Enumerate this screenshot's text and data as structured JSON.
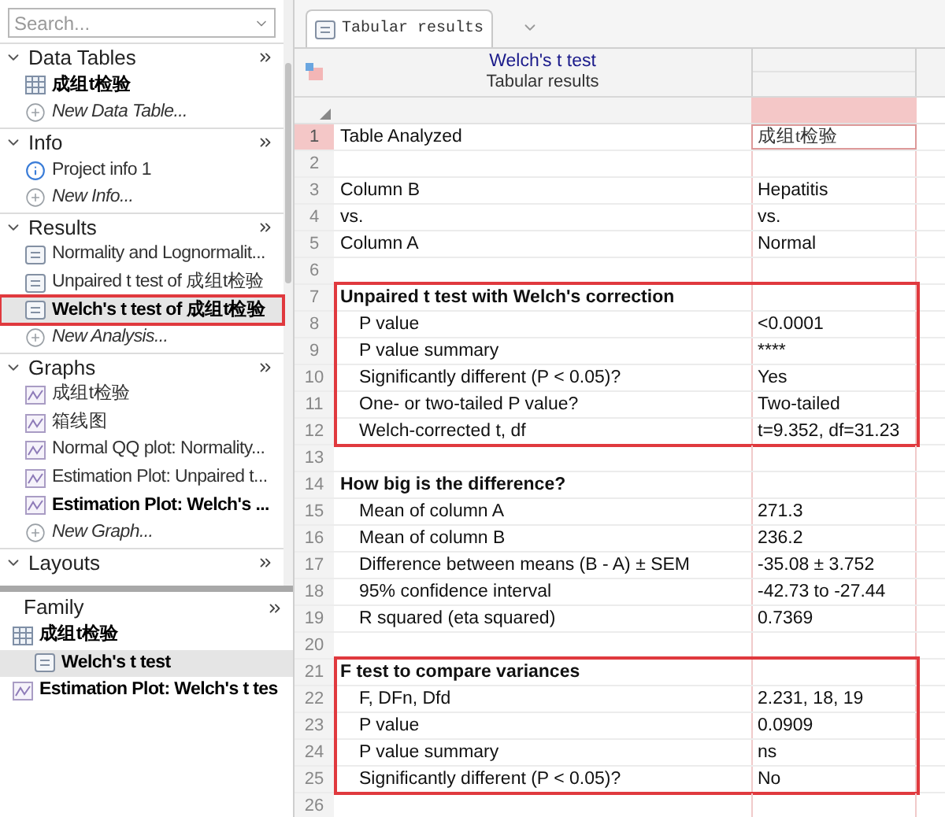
{
  "search": {
    "placeholder": "Search..."
  },
  "navigator": {
    "sections": [
      {
        "title": "Data Tables",
        "expanded": true,
        "items": [
          {
            "kind": "table",
            "label": "成组t检验",
            "bold": true,
            "selected": false,
            "highlighted": false
          },
          {
            "kind": "new",
            "label": "New Data Table...",
            "bold": false,
            "selected": false,
            "highlighted": false
          }
        ]
      },
      {
        "title": "Info",
        "expanded": true,
        "items": [
          {
            "kind": "info",
            "label": "Project info 1",
            "bold": false,
            "selected": false,
            "highlighted": false
          },
          {
            "kind": "new",
            "label": "New Info...",
            "bold": false,
            "selected": false,
            "highlighted": false
          }
        ]
      },
      {
        "title": "Results",
        "expanded": true,
        "items": [
          {
            "kind": "results",
            "label": "Normality and Lognormalit...",
            "bold": false,
            "selected": false,
            "highlighted": false
          },
          {
            "kind": "results",
            "label": "Unpaired t test of 成组t检验",
            "bold": false,
            "selected": false,
            "highlighted": false
          },
          {
            "kind": "results",
            "label": "Welch's t test of 成组t检验",
            "bold": true,
            "selected": true,
            "highlighted": true
          },
          {
            "kind": "new",
            "label": "New Analysis...",
            "bold": false,
            "selected": false,
            "highlighted": false
          }
        ]
      },
      {
        "title": "Graphs",
        "expanded": true,
        "items": [
          {
            "kind": "graph",
            "label": "成组t检验",
            "bold": false,
            "selected": false,
            "highlighted": false
          },
          {
            "kind": "graph",
            "label": "箱线图",
            "bold": false,
            "selected": false,
            "highlighted": false
          },
          {
            "kind": "graph",
            "label": "Normal QQ plot: Normality...",
            "bold": false,
            "selected": false,
            "highlighted": false
          },
          {
            "kind": "graph",
            "label": "Estimation Plot: Unpaired t...",
            "bold": false,
            "selected": false,
            "highlighted": false
          },
          {
            "kind": "graph",
            "label": "Estimation Plot: Welch's ...",
            "bold": true,
            "selected": false,
            "highlighted": false
          },
          {
            "kind": "new",
            "label": "New Graph...",
            "bold": false,
            "selected": false,
            "highlighted": false
          }
        ]
      },
      {
        "title": "Layouts",
        "expanded": true
      }
    ]
  },
  "family": {
    "title": "Family",
    "items": [
      {
        "kind": "table",
        "label": "成组t检验",
        "bold": true,
        "selected": false,
        "children": [
          {
            "kind": "results",
            "label": "Welch's t test",
            "bold": true,
            "selected": true
          }
        ]
      },
      {
        "kind": "graph",
        "label": "Estimation Plot: Welch's t tes",
        "bold": true,
        "selected": false
      }
    ]
  },
  "tabs": [
    {
      "label": "Tabular results",
      "selected": true
    }
  ],
  "sheet": {
    "title": "Welch's t test",
    "subtitle": "Tabular results",
    "value_column": {
      "selected": true
    },
    "groups": [
      {
        "kind": "plain",
        "rows": [
          {
            "number": "1",
            "kind": "plain",
            "label": "Table Analyzed",
            "value": "成组t检验",
            "selected": true
          },
          {
            "number": "2",
            "kind": "blank",
            "selected": false
          },
          {
            "number": "3",
            "kind": "plain",
            "label": "Column B",
            "value": "Hepatitis",
            "selected": false
          },
          {
            "number": "4",
            "kind": "plain",
            "label": "vs.",
            "value": "vs.",
            "selected": false
          },
          {
            "number": "5",
            "kind": "plain",
            "label": "Column A",
            "value": "Normal",
            "selected": false
          },
          {
            "number": "6",
            "kind": "blank",
            "selected": false
          }
        ]
      },
      {
        "kind": "framed",
        "rows": [
          {
            "number": "7",
            "kind": "title",
            "label": "Unpaired t test with Welch's correction",
            "selected": false
          },
          {
            "number": "8",
            "kind": "item",
            "label": "P value",
            "value": "<0.0001",
            "selected": false
          },
          {
            "number": "9",
            "kind": "item",
            "label": "P value summary",
            "value": "****",
            "selected": false
          },
          {
            "number": "10",
            "kind": "item",
            "label": "Significantly different (P < 0.05)?",
            "value": "Yes",
            "selected": false
          },
          {
            "number": "11",
            "kind": "item",
            "label": "One- or two-tailed P value?",
            "value": "Two-tailed",
            "selected": false
          },
          {
            "number": "12",
            "kind": "item",
            "label": "Welch-corrected  t, df",
            "value": "t=9.352, df=31.23",
            "selected": false
          }
        ]
      },
      {
        "kind": "plain",
        "rows": [
          {
            "number": "13",
            "kind": "blank",
            "selected": false
          },
          {
            "number": "14",
            "kind": "title",
            "label": "How big is the difference?",
            "selected": false
          },
          {
            "number": "15",
            "kind": "item",
            "label": "Mean of column A",
            "value": "271.3",
            "selected": false
          },
          {
            "number": "16",
            "kind": "item",
            "label": "Mean of column B",
            "value": "236.2",
            "selected": false
          },
          {
            "number": "17",
            "kind": "item",
            "label": "Difference between means (B - A) ± SEM",
            "value": "-35.08 ± 3.752",
            "selected": false
          },
          {
            "number": "18",
            "kind": "item",
            "label": "95% confidence interval",
            "value": "-42.73 to -27.44",
            "selected": false
          },
          {
            "number": "19",
            "kind": "item",
            "label": "R squared (eta squared)",
            "value": "0.7369",
            "selected": false
          },
          {
            "number": "20",
            "kind": "blank",
            "selected": false
          }
        ]
      },
      {
        "kind": "framed",
        "rows": [
          {
            "number": "21",
            "kind": "title",
            "label": "F test to compare variances",
            "selected": false
          },
          {
            "number": "22",
            "kind": "item",
            "label": "F, DFn, Dfd",
            "value": "2.231, 18, 19",
            "selected": false
          },
          {
            "number": "23",
            "kind": "item",
            "label": "P value",
            "value": "0.0909",
            "selected": false
          },
          {
            "number": "24",
            "kind": "item",
            "label": "P value summary",
            "value": "ns",
            "selected": false
          },
          {
            "number": "25",
            "kind": "item",
            "label": "Significantly different (P < 0.05)?",
            "value": "No",
            "selected": false
          }
        ]
      },
      {
        "kind": "plain",
        "rows": [
          {
            "number": "26",
            "kind": "blank",
            "selected": false
          }
        ]
      }
    ]
  }
}
